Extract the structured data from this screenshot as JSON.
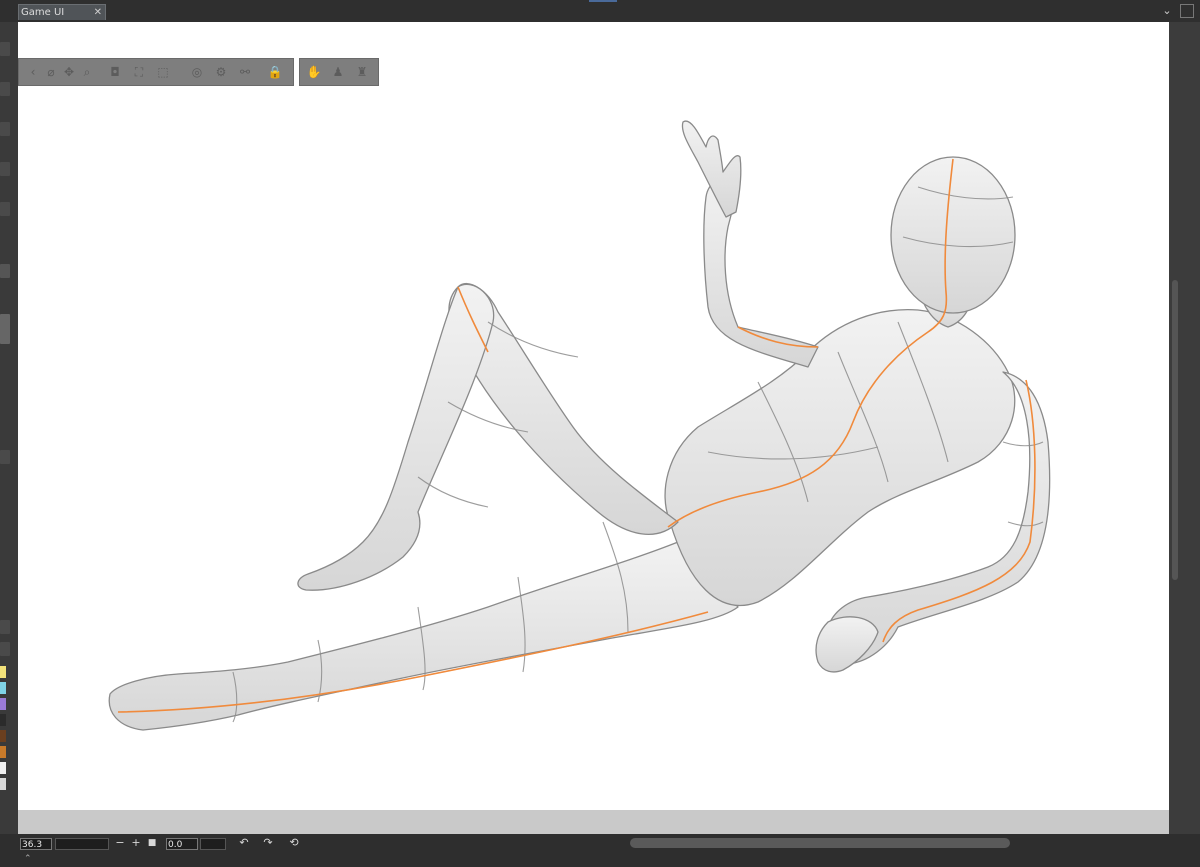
{
  "window": {
    "tab_title": "Game UI",
    "tab_close": "✕",
    "collapse_glyph": "⌄"
  },
  "toolbar": {
    "group1": [
      {
        "name": "nav-icon",
        "glyph": "‹"
      },
      {
        "name": "camera-rotate-icon",
        "glyph": "⌀"
      },
      {
        "name": "camera-pan-icon",
        "glyph": "✥"
      },
      {
        "name": "zoom-icon",
        "glyph": "⌕"
      },
      {
        "name": "snapshot-icon",
        "glyph": "◘"
      },
      {
        "name": "fit-icon",
        "glyph": "⛶"
      },
      {
        "name": "cube-icon",
        "glyph": "⬚"
      },
      {
        "name": "reset-pose-icon",
        "glyph": "◎"
      },
      {
        "name": "settings-icon",
        "glyph": "⚙"
      },
      {
        "name": "link-icon",
        "glyph": "⚯"
      },
      {
        "name": "lock-icon",
        "glyph": "🔒"
      }
    ],
    "group2": [
      {
        "name": "hand-pose-icon",
        "glyph": "✋"
      },
      {
        "name": "mannequin-icon",
        "glyph": "♟"
      },
      {
        "name": "pose-library-icon",
        "glyph": "♜"
      }
    ]
  },
  "statusbar": {
    "zoom_value": "36.3",
    "zoom_out": "−",
    "zoom_in": "+",
    "stop": "■",
    "rotation_value": "0.0",
    "rotate_left": "↶",
    "rotate_right": "↷",
    "reset_rotation": "⟲",
    "expand": "⌃"
  },
  "colors": {
    "guide_line": "#f08a3c",
    "mesh_line": "#8c8c8c",
    "body_fill": "#e6e6e6",
    "toolbar_bg": "#7e7e7e"
  }
}
